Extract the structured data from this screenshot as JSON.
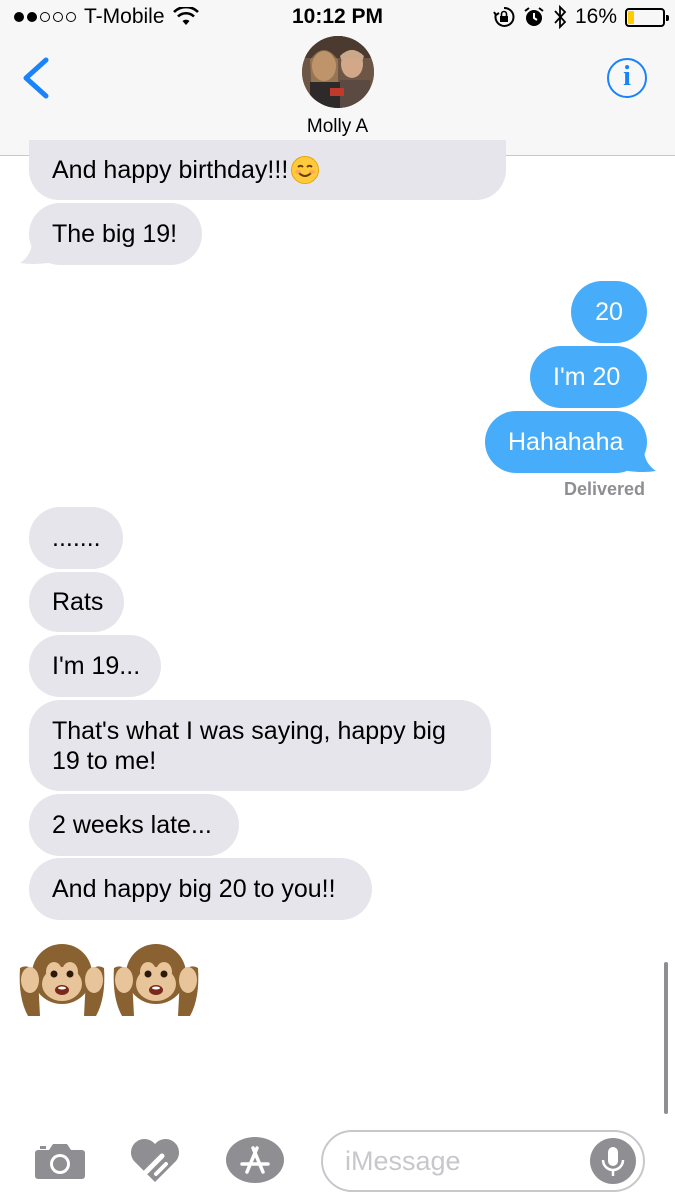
{
  "status_bar": {
    "carrier": "T-Mobile",
    "time": "10:12 PM",
    "battery_percent_label": "16%",
    "battery_level": 0.16,
    "battery_color": "#ffcc00",
    "signal_bars_filled": 2,
    "signal_bars_total": 5
  },
  "header": {
    "contact_name": "Molly A",
    "back_icon": "chevron-left-icon",
    "info_icon": "info-icon"
  },
  "messages": {
    "m1": "And happy birthday!!!",
    "m2": "The big 19!",
    "m3": "20",
    "m4": "I'm 20",
    "m5": "Hahahaha",
    "m6": ".......",
    "m7": "Rats",
    "m8": "I'm 19...",
    "m9": "That's what I was saying, happy big 19 to me!",
    "m10": "2 weeks late...",
    "m11": "And happy big 20 to you!!"
  },
  "delivered_label": "Delivered",
  "input_bar": {
    "placeholder": "iMessage",
    "camera_icon": "camera-icon",
    "digital_touch_icon": "digital-touch-heart-icon",
    "app_store_icon": "app-store-icon",
    "mic_icon": "microphone-icon"
  },
  "colors": {
    "incoming_bubble": "#e6e5eb",
    "outgoing_bubble": "#47adfa",
    "accent": "#1a82fb"
  }
}
